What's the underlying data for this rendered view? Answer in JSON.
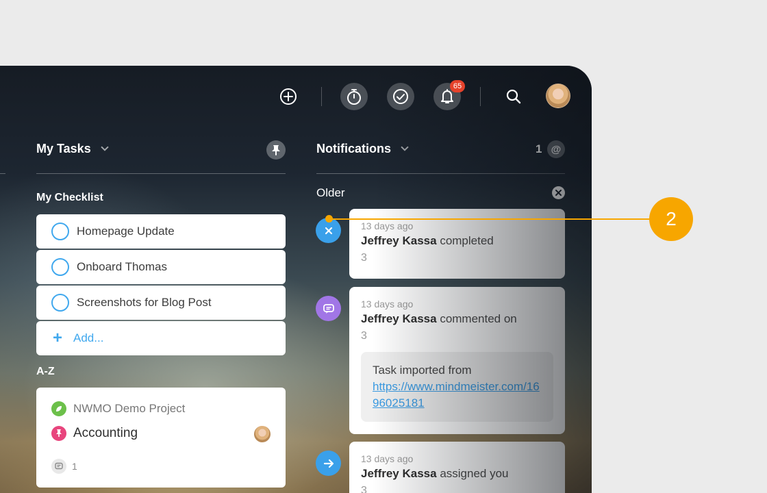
{
  "topbar": {
    "notification_badge": "65",
    "icons": [
      "add-circle-icon",
      "stopwatch-icon",
      "check-circle-icon",
      "bell-icon",
      "search-icon",
      "user-avatar"
    ]
  },
  "my_tasks": {
    "title": "My Tasks",
    "checklist_title": "My Checklist",
    "checklist": [
      {
        "label": "Homepage Update"
      },
      {
        "label": "Onboard Thomas"
      },
      {
        "label": "Screenshots for Blog Post"
      }
    ],
    "add_label": "Add...",
    "sort_label": "A-Z",
    "project_card": {
      "project": "NWMO Demo Project",
      "task": "Accounting",
      "comment_count": "1"
    }
  },
  "notifications": {
    "title": "Notifications",
    "mention_count": "1",
    "mention_symbol": "@",
    "section": "Older",
    "items": [
      {
        "time": "13 days ago",
        "user": "Jeffrey Kassa",
        "action": "completed",
        "ref": "3",
        "icon": "close-icon",
        "color": "#3aa0ea"
      },
      {
        "time": "13 days ago",
        "user": "Jeffrey Kassa",
        "action": "commented on",
        "ref": "3",
        "icon": "comment-icon",
        "color": "#a176e6",
        "quote_text": "Task imported from",
        "quote_link": "https://www.mindmeister.com/1696025181"
      },
      {
        "time": "13 days ago",
        "user": "Jeffrey Kassa",
        "action": "assigned you",
        "ref": "3",
        "icon": "arrow-right-icon",
        "color": "#3aa0ea"
      }
    ]
  },
  "callout": {
    "label": "2",
    "color": "#f7a600"
  }
}
